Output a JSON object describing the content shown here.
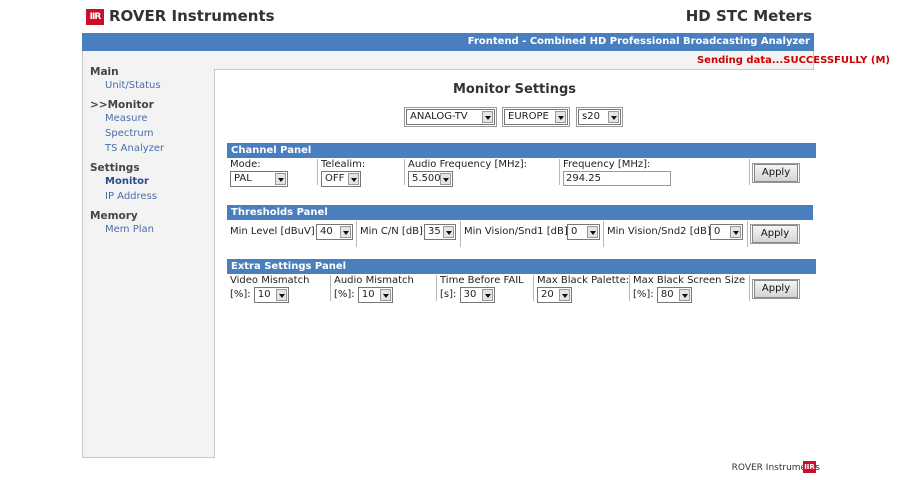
{
  "header": {
    "logo_text": "IIR",
    "brand": "ROVER Instruments",
    "product": "HD STC Meters",
    "subtitle": "Frontend - Combined HD Professional Broadcasting Analyzer"
  },
  "status": "Sending data...SUCCESSFULLY (M)",
  "sidebar": {
    "groups": [
      {
        "title": "Main",
        "items": [
          "Unit/Status"
        ]
      },
      {
        "title": ">>Monitor",
        "items": [
          "Measure",
          "Spectrum",
          "TS Analyzer"
        ]
      },
      {
        "title": "Settings",
        "items": [
          "Monitor",
          "IP Address"
        ]
      },
      {
        "title": "Memory",
        "items": [
          "Mem Plan"
        ]
      }
    ]
  },
  "main": {
    "title": "Monitor Settings",
    "top_selects": {
      "standard": "ANALOG-TV",
      "region": "EUROPE",
      "channel": "s20"
    }
  },
  "channel_panel": {
    "title": "Channel Panel",
    "mode_label": "Mode:",
    "mode_value": "PAL",
    "telealim_label": "Telealim:",
    "telealim_value": "OFF",
    "audio_freq_label": "Audio Frequency [MHz]:",
    "audio_freq_value": "5.500",
    "frequency_label": "Frequency [MHz]:",
    "frequency_value": "294.25",
    "apply_label": "Apply"
  },
  "thresholds_panel": {
    "title": "Thresholds Panel",
    "min_level_label": "Min Level [dBuV]:",
    "min_level_value": "40",
    "min_cn_label": "Min C/N [dB]:",
    "min_cn_value": "35",
    "min_vs1_label": "Min Vision/Snd1 [dB]:",
    "min_vs1_value": "0",
    "min_vs2_label": "Min Vision/Snd2 [dB]:",
    "min_vs2_value": "0",
    "apply_label": "Apply"
  },
  "extra_panel": {
    "title": "Extra Settings Panel",
    "video_mismatch_label": "Video Mismatch",
    "video_mismatch_unit": "[%]:",
    "video_mismatch_value": "10",
    "audio_mismatch_label": "Audio Mismatch",
    "audio_mismatch_unit": "[%]:",
    "audio_mismatch_value": "10",
    "time_fail_label": "Time Before FAIL",
    "time_fail_unit": "[s]:",
    "time_fail_value": "30",
    "black_palette_label": "Max Black Palette:",
    "black_palette_value": "20",
    "black_screen_label": "Max Black Screen Size",
    "black_screen_unit": "[%]:",
    "black_screen_value": "80",
    "apply_label": "Apply"
  },
  "footer": {
    "text": "ROVER Instruments",
    "logo_text": "IIR"
  },
  "colors": {
    "accent_blue": "#4a7fbf",
    "brand_red": "#c8102e",
    "status_red": "#cc0000",
    "link_blue": "#4a6fa8"
  }
}
